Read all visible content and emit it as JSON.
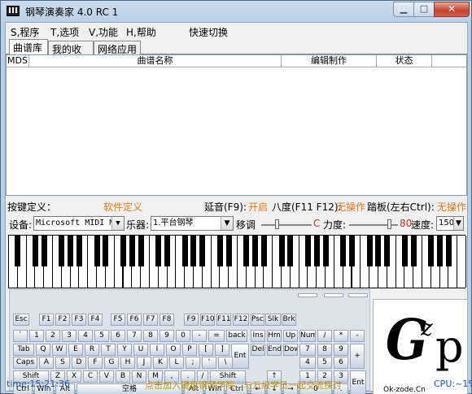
{
  "window": {
    "title": "钢琴演奏家 4.0 RC 1"
  },
  "menu": [
    {
      "label": "S,程序"
    },
    {
      "label": "T,选项"
    },
    {
      "label": "V,功能"
    },
    {
      "label": "H,帮助"
    },
    {
      "label": "快速切换"
    }
  ],
  "tabs": [
    {
      "label": "曲谱库"
    },
    {
      "label": "我的收藏"
    },
    {
      "label": "网络应用"
    }
  ],
  "list": {
    "columns": [
      "MDS",
      "曲谱名称",
      "编辑制作",
      "状态"
    ]
  },
  "status1": {
    "key_def_label": "按键定义：",
    "key_def_value": "软件定义",
    "sustain_label": "延音(F9):",
    "sustain_value": "开启",
    "octave_label": "八度(F11 F12):",
    "octave_value": "无操作",
    "pedal_label": "踏板(左右Ctrl):",
    "pedal_value": "无操作"
  },
  "controls": {
    "device_label": "设备:",
    "device_value": "Microsoft MIDI M",
    "instrument_label": "乐器:",
    "instrument_value": "1.平台钢琴",
    "transpose_label": "移调",
    "transpose_value": "C",
    "strength_label": "力度:",
    "strength_value": "80",
    "speed_label": "速度:",
    "speed_value": "150"
  },
  "keyboard": {
    "rows": [
      [
        "Esc",
        "F1",
        "F2",
        "F3",
        "F4",
        "F5",
        "F6",
        "F7",
        "F8",
        "F9",
        "F10",
        "F11",
        "F12",
        "Psc",
        "Slk",
        "Brk"
      ],
      [
        "`",
        "1",
        "2",
        "3",
        "4",
        "5",
        "6",
        "7",
        "8",
        "9",
        "0",
        "-",
        "=",
        "back",
        "Ins",
        "Hm",
        "Up",
        "Num",
        "/",
        "*",
        "-"
      ],
      [
        "Tab",
        "Q",
        "W",
        "E",
        "R",
        "T",
        "Y",
        "U",
        "I",
        "O",
        "P",
        "[",
        "]",
        "Ent",
        "Del",
        "End",
        "Dow",
        "7",
        "8",
        "9",
        "+"
      ],
      [
        "Caps",
        "A",
        "S",
        "D",
        "F",
        "G",
        "H",
        "J",
        "K",
        "L",
        ";",
        "'",
        "\\",
        "4",
        "5",
        "6"
      ],
      [
        "Shift",
        "Z",
        "X",
        "C",
        "V",
        "B",
        "N",
        "M",
        ",",
        ".",
        "/",
        "Shift",
        "↑",
        "1",
        "2",
        "3",
        "Ent"
      ],
      [
        "Ctrl",
        "Win",
        "Alt",
        "空格",
        "Alt",
        "Win",
        "Ctrl",
        "←",
        "↓",
        "→",
        "0",
        "."
      ]
    ]
  },
  "logo": {
    "g": "G",
    "z": "z",
    "p": "p",
    "site": "Ok-zode.Cn"
  },
  "statusbar": {
    "time": "time:15:21:36",
    "ad": "点击加入键盘钢琴学院，与万级学员一起交流探讨",
    "cpu": "CPU:~1%"
  }
}
